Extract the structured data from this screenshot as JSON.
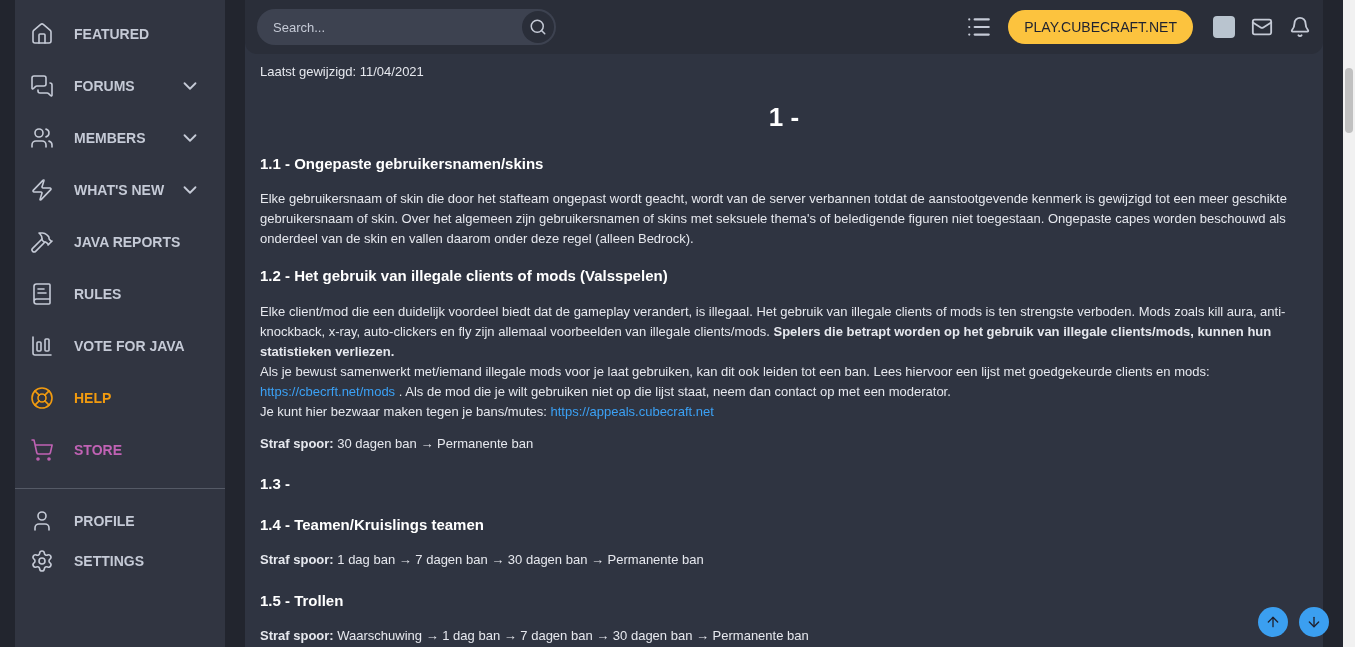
{
  "sidebar": {
    "groups": [
      {
        "items": [
          {
            "label": "FEATURED",
            "has_submenu": false,
            "color": "#c5cad6"
          },
          {
            "label": "FORUMS",
            "has_submenu": true,
            "color": "#c5cad6"
          },
          {
            "label": "MEMBERS",
            "has_submenu": true,
            "color": "#c5cad6"
          },
          {
            "label": "WHAT'S NEW",
            "has_submenu": true,
            "color": "#c5cad6"
          },
          {
            "label": "JAVA REPORTS",
            "has_submenu": false,
            "color": "#c5cad6"
          },
          {
            "label": "RULES",
            "has_submenu": false,
            "color": "#c5cad6"
          },
          {
            "label": "VOTE FOR JAVA",
            "has_submenu": false,
            "color": "#c5cad6"
          },
          {
            "label": "HELP",
            "has_submenu": false,
            "color": "#f29b0f"
          },
          {
            "label": "STORE",
            "has_submenu": false,
            "color": "#c062b4"
          }
        ]
      },
      {
        "items": [
          {
            "label": "PROFILE",
            "has_submenu": false,
            "color": "#c5cad6"
          },
          {
            "label": "SETTINGS",
            "has_submenu": false,
            "color": "#c5cad6"
          }
        ]
      }
    ]
  },
  "header": {
    "search": {
      "placeholder": "Search..."
    },
    "server_button": "PLAY.CUBECRAFT.NET"
  },
  "content": [
    {
      "kind": "meta",
      "text": "Laatst gewijzigd: 11/04/2021"
    },
    {
      "kind": "title",
      "text": "1 -"
    },
    {
      "kind": "heading",
      "text": "1.1 - Ongepaste gebruikersnamen/skins"
    },
    {
      "kind": "paragraph",
      "lines": [
        [
          {
            "kind": "text",
            "text": "Elke gebruikersnaam of skin die door het stafteam ongepast wordt geacht, wordt van de server verbannen totdat de aanstootgevende kenmerk is gewijzigd tot een meer geschikte gebruikersnaam of skin. Over het algemeen zijn gebruikersnamen of skins met seksuele thema's of beledigende figuren niet toegestaan. Ongepaste capes worden beschouwd als onderdeel van de skin en vallen daarom onder deze regel (alleen Bedrock)."
          }
        ]
      ]
    },
    {
      "kind": "heading",
      "text": "1.2 - Het gebruik van illegale clients of mods (Valsspelen)"
    },
    {
      "kind": "paragraph",
      "lines": [
        [
          {
            "kind": "text",
            "text": "Elke client/mod die een duidelijk voordeel biedt dat de gameplay verandert, is illegaal. Het gebruik van illegale clients of mods is ten strengste verboden. Mods zoals kill aura, anti-knockback, x-ray, auto-clickers en fly zijn allemaal voorbeelden van illegale clients/mods. **Spelers die betrapt worden op het gebruik van illegale clients/mods, kunnen hun statistieken verliezen.**"
          }
        ],
        [
          {
            "kind": "text",
            "text": "Als je bewust samenwerkt met/iemand illegale mods voor je laat gebruiken, kan dit ook leiden tot een ban. Lees hiervoor een lijst met goedgekeurde clients en mods:"
          },
          {
            "kind": "link",
            "text": "https://cbecrft.net/mods"
          },
          {
            "kind": "text",
            "text": ". Als de mod die je wilt gebruiken niet op die lijst staat, neem dan contact op met een moderator."
          }
        ],
        [
          {
            "kind": "text",
            "text": "Je kunt hier bezwaar maken tegen je bans/mutes:"
          },
          {
            "kind": "link",
            "text": "https://appeals.cubecraft.net"
          }
        ]
      ]
    },
    {
      "kind": "penalty",
      "text": "**Straf spoor:** 30 dagen ban → Permanente ban"
    },
    {
      "kind": "heading",
      "text": "1.3 -"
    },
    {
      "kind": "heading",
      "text": "1.4 - Teamen/Kruislings teamen"
    },
    {
      "kind": "penalty",
      "text": "**Straf spoor:** 1 dag ban → 7 dagen ban → 30 dagen ban → Permanente ban"
    },
    {
      "kind": "heading",
      "text": "1.5 - Trollen"
    },
    {
      "kind": "penalty",
      "text": "**Straf spoor:** Waarschuwing → 1 dag ban → 7 dagen ban → 30 dagen ban → Permanente ban"
    }
  ]
}
